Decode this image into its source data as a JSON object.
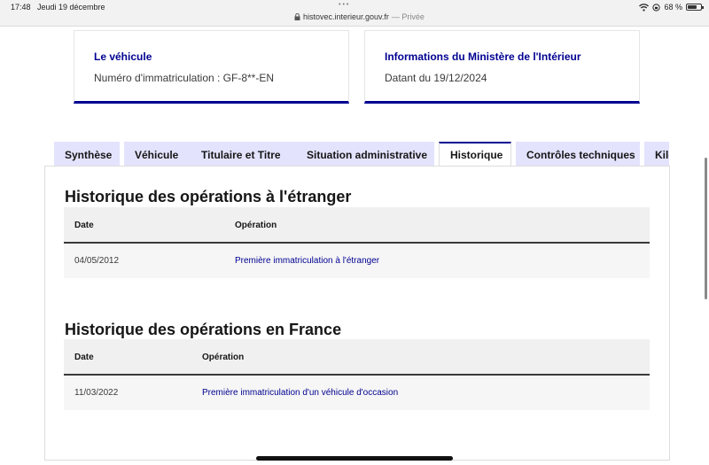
{
  "statusbar": {
    "time": "17:48",
    "date": "Jeudi 19 décembre",
    "dots": "•••",
    "url": "histovec.interieur.gouv.fr",
    "private": "— Privée",
    "battery": "68 %",
    "battery_level": 0.68,
    "icons": [
      "wifi-icon",
      "rotation-lock-icon",
      "battery-icon",
      "lock-icon"
    ]
  },
  "cards": {
    "vehicle_title": "Le véhicule",
    "vehicle_text": "Numéro d'immatriculation : GF-8**-EN",
    "ministry_title": "Informations du Ministère de l'Intérieur",
    "ministry_text": "Datant du 19/12/2024"
  },
  "tabs": [
    {
      "label": "Synthèse",
      "active": false
    },
    {
      "label": "Véhicule",
      "active": false
    },
    {
      "label": "Titulaire et Titre",
      "active": false
    },
    {
      "label": "Situation administrative",
      "active": false
    },
    {
      "label": "Historique",
      "active": true
    },
    {
      "label": "Contrôles techniques",
      "active": false
    },
    {
      "label": "Kilo",
      "active": false
    }
  ],
  "historique_etranger": {
    "title": "Historique des opérations à l'étranger",
    "headers": [
      "Date",
      "Opération"
    ],
    "rows": [
      [
        "04/05/2012",
        "Première immatriculation à l'étranger"
      ]
    ]
  },
  "historique_france": {
    "title": "Historique des opérations en France",
    "headers": [
      "Date",
      "Opération"
    ],
    "rows": [
      [
        "11/03/2022",
        "Première immatriculation d'un véhicule d'occasion"
      ]
    ]
  },
  "colors": {
    "accent": "#000091",
    "tab_bg": "#e3e3fd",
    "table_header": "#f0f0f0",
    "table_row": "#f6f6f6"
  }
}
